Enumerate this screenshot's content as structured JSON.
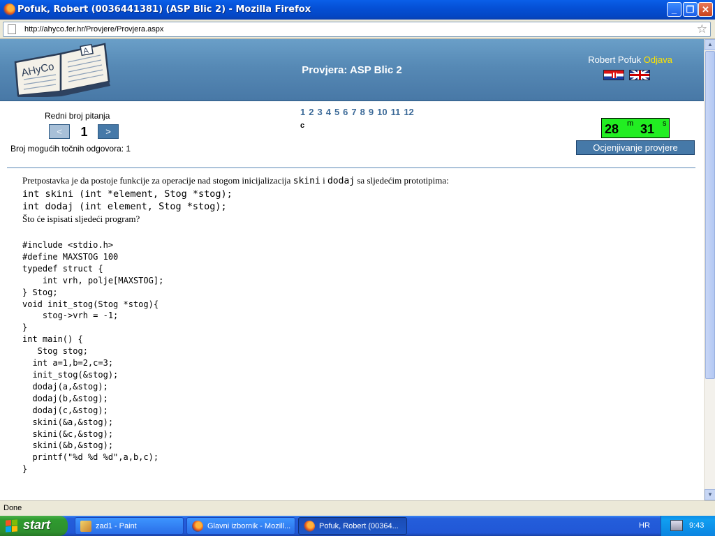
{
  "window": {
    "title": "Pofuk, Robert (0036441381) (ASP Blic 2) - Mozilla Firefox",
    "minimize": "_",
    "maximize": "❐",
    "close": "✕"
  },
  "address": {
    "url": "http://ahyco.fer.hr/Provjere/Provjera.aspx"
  },
  "header": {
    "logo_text": "AHyCo",
    "logo_letter": "A",
    "title": "Provjera: ASP Blic 2",
    "user_name": "Robert Pofuk",
    "logout": "Odjava"
  },
  "navigation": {
    "label": "Redni broj pitanja",
    "prev": "<",
    "next": ">",
    "current": "1",
    "answers_count": "Broj mogućih točnih odgovora: 1",
    "question_links": [
      "1",
      "2",
      "3",
      "4",
      "5",
      "6",
      "7",
      "8",
      "9",
      "10",
      "11",
      "12"
    ],
    "status_marker": "c"
  },
  "timer": {
    "minutes": "28",
    "minutes_unit": "m",
    "seconds": "31",
    "seconds_unit": "s",
    "grade_button": "Ocjenjivanje provjere"
  },
  "question": {
    "intro_a": "Pretpostavka je da postoje funkcije za operacije nad stogom inicijalizacija ",
    "fn1": "skini",
    "intro_b": " i ",
    "fn2": "dodaj",
    "intro_c": " sa sljedećim prototipima:",
    "proto1": "int skini (int *element, Stog *stog);",
    "proto2": "int dodaj (int element, Stog *stog);",
    "ask": "Što će ispisati sljedeći program?",
    "code": "#include <stdio.h>\n#define MAXSTOG 100\ntypedef struct {\n    int vrh, polje[MAXSTOG];\n} Stog;\nvoid init_stog(Stog *stog){\n    stog->vrh = -1;\n}\nint main() {\n   Stog stog;\n  int a=1,b=2,c=3;\n  init_stog(&stog);\n  dodaj(a,&stog);\n  dodaj(b,&stog);\n  dodaj(c,&stog);\n  skini(&a,&stog);\n  skini(&c,&stog);\n  skini(&b,&stog);\n  printf(\"%d %d %d\",a,b,c);\n}"
  },
  "statusbar": {
    "text": "Done"
  },
  "taskbar": {
    "start": "start",
    "tasks": [
      {
        "label": "zad1 - Paint",
        "icon": "paint-icon"
      },
      {
        "label": "Glavni izbornik - Mozill...",
        "icon": "firefox-icon"
      },
      {
        "label": "Pofuk, Robert (00364...",
        "icon": "firefox-icon"
      }
    ],
    "language": "HR",
    "clock": "9:43"
  }
}
